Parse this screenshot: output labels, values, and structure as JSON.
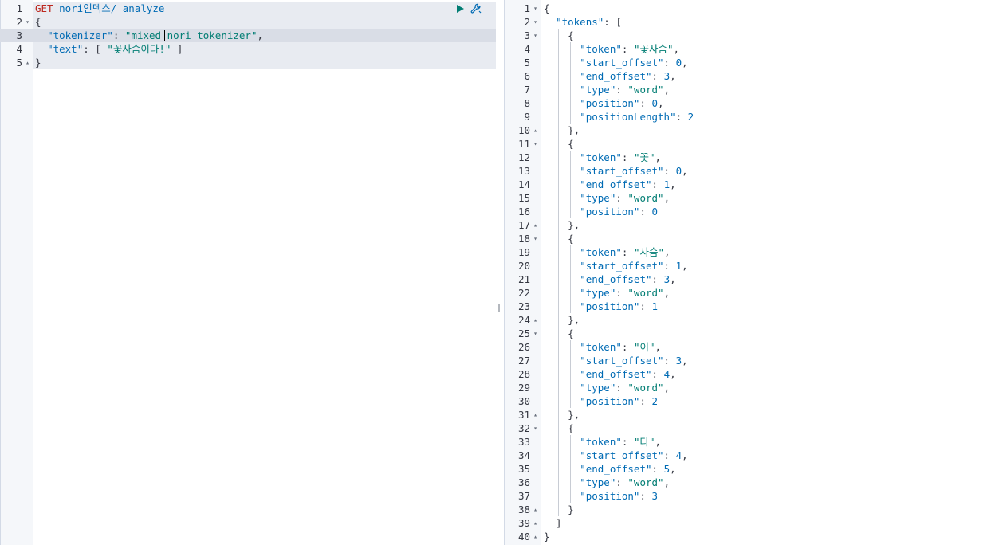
{
  "request": {
    "lines": [
      {
        "n": "1",
        "fold": "",
        "tokens": [
          [
            "method",
            "GET"
          ],
          [
            "punc",
            " "
          ],
          [
            "path",
            "nori인덱스/_analyze"
          ]
        ]
      },
      {
        "n": "2",
        "fold": "▾",
        "tokens": [
          [
            "punc",
            "{"
          ]
        ]
      },
      {
        "n": "3",
        "fold": "",
        "tokens": [
          [
            "punc",
            "  "
          ],
          [
            "key",
            "\"tokenizer\""
          ],
          [
            "punc",
            ": "
          ],
          [
            "str",
            "\"mixed_nori_tokenizer\""
          ],
          [
            "punc",
            ","
          ]
        ]
      },
      {
        "n": "4",
        "fold": "",
        "tokens": [
          [
            "punc",
            "  "
          ],
          [
            "key",
            "\"text\""
          ],
          [
            "punc",
            ": [ "
          ],
          [
            "str",
            "\"꽃사슴이다!\""
          ],
          [
            "punc",
            " ]"
          ]
        ]
      },
      {
        "n": "5",
        "fold": "▴",
        "tokens": [
          [
            "punc",
            "}"
          ]
        ]
      }
    ]
  },
  "response": {
    "lines": [
      {
        "n": "1",
        "fold": "▾",
        "indent": 0,
        "tokens": [
          [
            "punc",
            "{"
          ]
        ]
      },
      {
        "n": "2",
        "fold": "▾",
        "indent": 0,
        "tokens": [
          [
            "punc",
            "  "
          ],
          [
            "key",
            "\"tokens\""
          ],
          [
            "punc",
            ": ["
          ]
        ]
      },
      {
        "n": "3",
        "fold": "▾",
        "indent": 1,
        "tokens": [
          [
            "punc",
            "{"
          ]
        ]
      },
      {
        "n": "4",
        "fold": "",
        "indent": 2,
        "tokens": [
          [
            "key",
            "\"token\""
          ],
          [
            "punc",
            ": "
          ],
          [
            "str",
            "\"꽃사슴\""
          ],
          [
            "punc",
            ","
          ]
        ]
      },
      {
        "n": "5",
        "fold": "",
        "indent": 2,
        "tokens": [
          [
            "key",
            "\"start_offset\""
          ],
          [
            "punc",
            ": "
          ],
          [
            "num",
            "0"
          ],
          [
            "punc",
            ","
          ]
        ]
      },
      {
        "n": "6",
        "fold": "",
        "indent": 2,
        "tokens": [
          [
            "key",
            "\"end_offset\""
          ],
          [
            "punc",
            ": "
          ],
          [
            "num",
            "3"
          ],
          [
            "punc",
            ","
          ]
        ]
      },
      {
        "n": "7",
        "fold": "",
        "indent": 2,
        "tokens": [
          [
            "key",
            "\"type\""
          ],
          [
            "punc",
            ": "
          ],
          [
            "str",
            "\"word\""
          ],
          [
            "punc",
            ","
          ]
        ]
      },
      {
        "n": "8",
        "fold": "",
        "indent": 2,
        "tokens": [
          [
            "key",
            "\"position\""
          ],
          [
            "punc",
            ": "
          ],
          [
            "num",
            "0"
          ],
          [
            "punc",
            ","
          ]
        ]
      },
      {
        "n": "9",
        "fold": "",
        "indent": 2,
        "tokens": [
          [
            "key",
            "\"positionLength\""
          ],
          [
            "punc",
            ": "
          ],
          [
            "num",
            "2"
          ]
        ]
      },
      {
        "n": "10",
        "fold": "▴",
        "indent": 1,
        "tokens": [
          [
            "punc",
            "},"
          ]
        ]
      },
      {
        "n": "11",
        "fold": "▾",
        "indent": 1,
        "tokens": [
          [
            "punc",
            "{"
          ]
        ]
      },
      {
        "n": "12",
        "fold": "",
        "indent": 2,
        "tokens": [
          [
            "key",
            "\"token\""
          ],
          [
            "punc",
            ": "
          ],
          [
            "str",
            "\"꽃\""
          ],
          [
            "punc",
            ","
          ]
        ]
      },
      {
        "n": "13",
        "fold": "",
        "indent": 2,
        "tokens": [
          [
            "key",
            "\"start_offset\""
          ],
          [
            "punc",
            ": "
          ],
          [
            "num",
            "0"
          ],
          [
            "punc",
            ","
          ]
        ]
      },
      {
        "n": "14",
        "fold": "",
        "indent": 2,
        "tokens": [
          [
            "key",
            "\"end_offset\""
          ],
          [
            "punc",
            ": "
          ],
          [
            "num",
            "1"
          ],
          [
            "punc",
            ","
          ]
        ]
      },
      {
        "n": "15",
        "fold": "",
        "indent": 2,
        "tokens": [
          [
            "key",
            "\"type\""
          ],
          [
            "punc",
            ": "
          ],
          [
            "str",
            "\"word\""
          ],
          [
            "punc",
            ","
          ]
        ]
      },
      {
        "n": "16",
        "fold": "",
        "indent": 2,
        "tokens": [
          [
            "key",
            "\"position\""
          ],
          [
            "punc",
            ": "
          ],
          [
            "num",
            "0"
          ]
        ]
      },
      {
        "n": "17",
        "fold": "▴",
        "indent": 1,
        "tokens": [
          [
            "punc",
            "},"
          ]
        ]
      },
      {
        "n": "18",
        "fold": "▾",
        "indent": 1,
        "tokens": [
          [
            "punc",
            "{"
          ]
        ]
      },
      {
        "n": "19",
        "fold": "",
        "indent": 2,
        "tokens": [
          [
            "key",
            "\"token\""
          ],
          [
            "punc",
            ": "
          ],
          [
            "str",
            "\"사슴\""
          ],
          [
            "punc",
            ","
          ]
        ]
      },
      {
        "n": "20",
        "fold": "",
        "indent": 2,
        "tokens": [
          [
            "key",
            "\"start_offset\""
          ],
          [
            "punc",
            ": "
          ],
          [
            "num",
            "1"
          ],
          [
            "punc",
            ","
          ]
        ]
      },
      {
        "n": "21",
        "fold": "",
        "indent": 2,
        "tokens": [
          [
            "key",
            "\"end_offset\""
          ],
          [
            "punc",
            ": "
          ],
          [
            "num",
            "3"
          ],
          [
            "punc",
            ","
          ]
        ]
      },
      {
        "n": "22",
        "fold": "",
        "indent": 2,
        "tokens": [
          [
            "key",
            "\"type\""
          ],
          [
            "punc",
            ": "
          ],
          [
            "str",
            "\"word\""
          ],
          [
            "punc",
            ","
          ]
        ]
      },
      {
        "n": "23",
        "fold": "",
        "indent": 2,
        "tokens": [
          [
            "key",
            "\"position\""
          ],
          [
            "punc",
            ": "
          ],
          [
            "num",
            "1"
          ]
        ]
      },
      {
        "n": "24",
        "fold": "▴",
        "indent": 1,
        "tokens": [
          [
            "punc",
            "},"
          ]
        ]
      },
      {
        "n": "25",
        "fold": "▾",
        "indent": 1,
        "tokens": [
          [
            "punc",
            "{"
          ]
        ]
      },
      {
        "n": "26",
        "fold": "",
        "indent": 2,
        "tokens": [
          [
            "key",
            "\"token\""
          ],
          [
            "punc",
            ": "
          ],
          [
            "str",
            "\"이\""
          ],
          [
            "punc",
            ","
          ]
        ]
      },
      {
        "n": "27",
        "fold": "",
        "indent": 2,
        "tokens": [
          [
            "key",
            "\"start_offset\""
          ],
          [
            "punc",
            ": "
          ],
          [
            "num",
            "3"
          ],
          [
            "punc",
            ","
          ]
        ]
      },
      {
        "n": "28",
        "fold": "",
        "indent": 2,
        "tokens": [
          [
            "key",
            "\"end_offset\""
          ],
          [
            "punc",
            ": "
          ],
          [
            "num",
            "4"
          ],
          [
            "punc",
            ","
          ]
        ]
      },
      {
        "n": "29",
        "fold": "",
        "indent": 2,
        "tokens": [
          [
            "key",
            "\"type\""
          ],
          [
            "punc",
            ": "
          ],
          [
            "str",
            "\"word\""
          ],
          [
            "punc",
            ","
          ]
        ]
      },
      {
        "n": "30",
        "fold": "",
        "indent": 2,
        "tokens": [
          [
            "key",
            "\"position\""
          ],
          [
            "punc",
            ": "
          ],
          [
            "num",
            "2"
          ]
        ]
      },
      {
        "n": "31",
        "fold": "▴",
        "indent": 1,
        "tokens": [
          [
            "punc",
            "},"
          ]
        ]
      },
      {
        "n": "32",
        "fold": "▾",
        "indent": 1,
        "tokens": [
          [
            "punc",
            "{"
          ]
        ]
      },
      {
        "n": "33",
        "fold": "",
        "indent": 2,
        "tokens": [
          [
            "key",
            "\"token\""
          ],
          [
            "punc",
            ": "
          ],
          [
            "str",
            "\"다\""
          ],
          [
            "punc",
            ","
          ]
        ]
      },
      {
        "n": "34",
        "fold": "",
        "indent": 2,
        "tokens": [
          [
            "key",
            "\"start_offset\""
          ],
          [
            "punc",
            ": "
          ],
          [
            "num",
            "4"
          ],
          [
            "punc",
            ","
          ]
        ]
      },
      {
        "n": "35",
        "fold": "",
        "indent": 2,
        "tokens": [
          [
            "key",
            "\"end_offset\""
          ],
          [
            "punc",
            ": "
          ],
          [
            "num",
            "5"
          ],
          [
            "punc",
            ","
          ]
        ]
      },
      {
        "n": "36",
        "fold": "",
        "indent": 2,
        "tokens": [
          [
            "key",
            "\"type\""
          ],
          [
            "punc",
            ": "
          ],
          [
            "str",
            "\"word\""
          ],
          [
            "punc",
            ","
          ]
        ]
      },
      {
        "n": "37",
        "fold": "",
        "indent": 2,
        "tokens": [
          [
            "key",
            "\"position\""
          ],
          [
            "punc",
            ": "
          ],
          [
            "num",
            "3"
          ]
        ]
      },
      {
        "n": "38",
        "fold": "▴",
        "indent": 1,
        "tokens": [
          [
            "punc",
            "}"
          ]
        ]
      },
      {
        "n": "39",
        "fold": "▴",
        "indent": 0,
        "tokens": [
          [
            "punc",
            "  ]"
          ]
        ]
      },
      {
        "n": "40",
        "fold": "▴",
        "indent": 0,
        "tokens": [
          [
            "punc",
            "}"
          ]
        ]
      }
    ]
  },
  "toolbar": {
    "play_icon": "play-icon",
    "wrench_icon": "wrench-icon"
  },
  "colors": {
    "method": "#bd271e",
    "path": "#006bb4",
    "string": "#017d73",
    "play": "#017d73",
    "wrench": "#006bb4"
  }
}
